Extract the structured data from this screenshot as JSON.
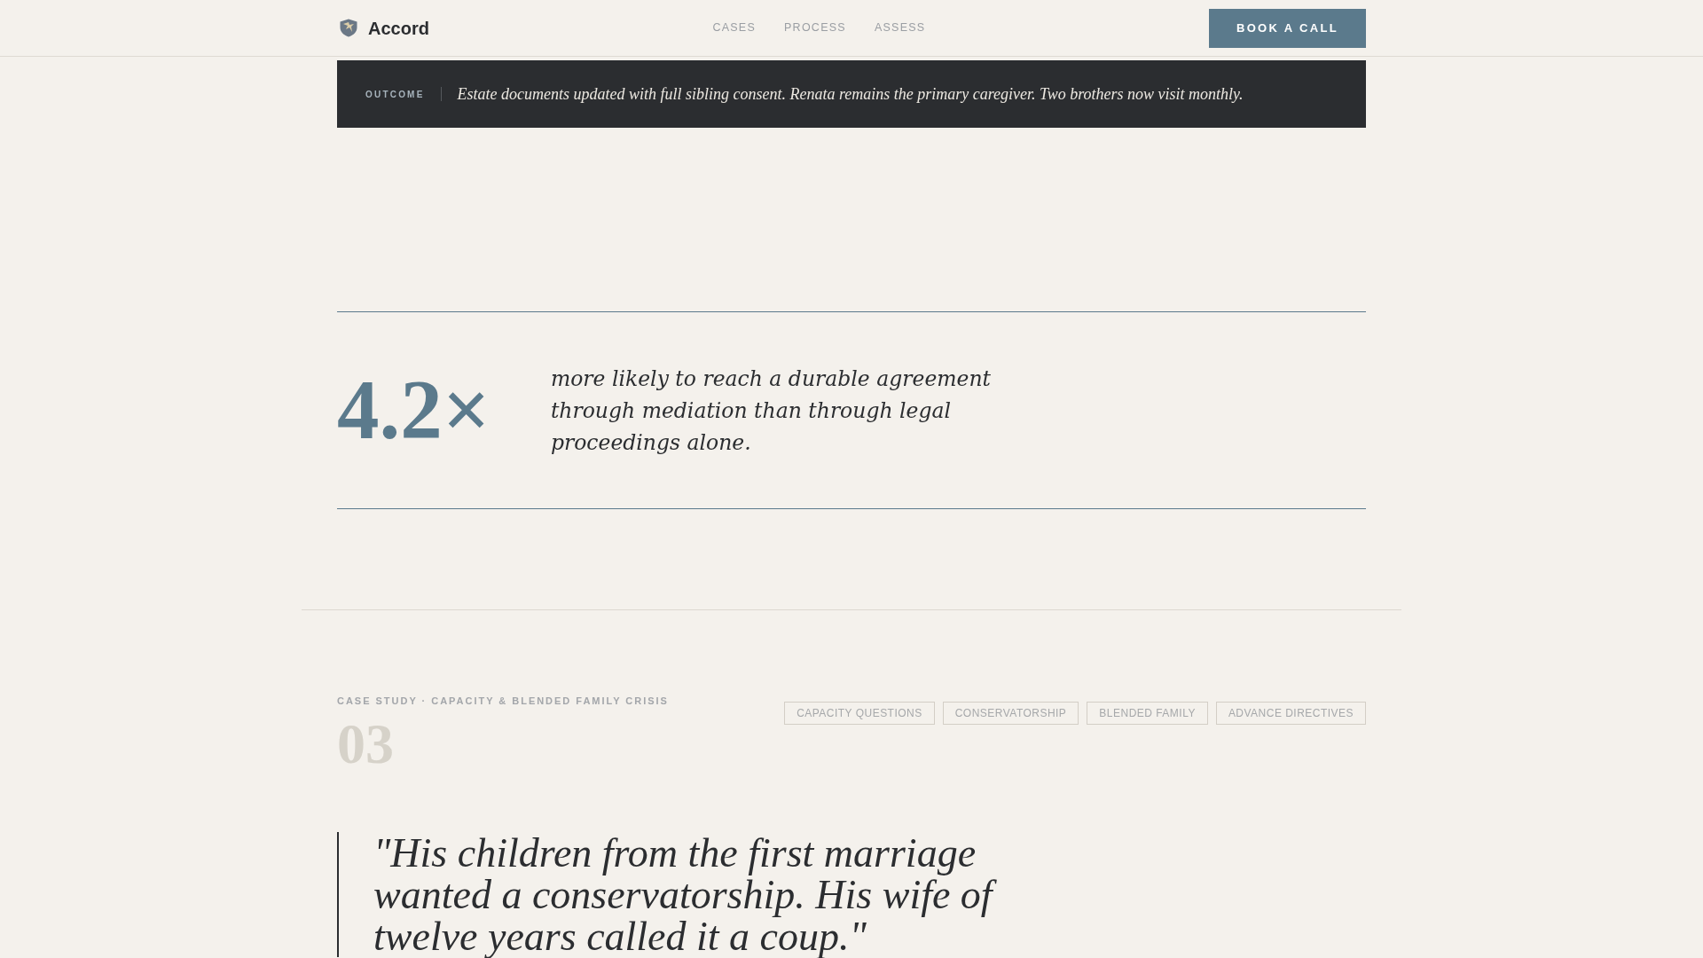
{
  "header": {
    "brand": "Accord",
    "nav": [
      "CASES",
      "PROCESS",
      "ASSESS"
    ],
    "cta": "BOOK A CALL"
  },
  "outcome": {
    "label": "OUTCOME",
    "text": "Estate documents updated with full sibling consent. Renata remains the primary caregiver. Two brothers now visit monthly."
  },
  "stat": {
    "value": "4.2×",
    "text": "more likely to reach a durable agreement through mediation than through legal proceedings alone."
  },
  "case_study": {
    "eyebrow": "CASE STUDY · CAPACITY & BLENDED FAMILY CRISIS",
    "number": "03",
    "tags": [
      "CAPACITY QUESTIONS",
      "CONSERVATORSHIP",
      "BLENDED FAMILY",
      "ADVANCE DIRECTIVES"
    ],
    "quote": "\"His children from the first marriage wanted a conservatorship. His wife of twelve years called it a coup.\""
  }
}
